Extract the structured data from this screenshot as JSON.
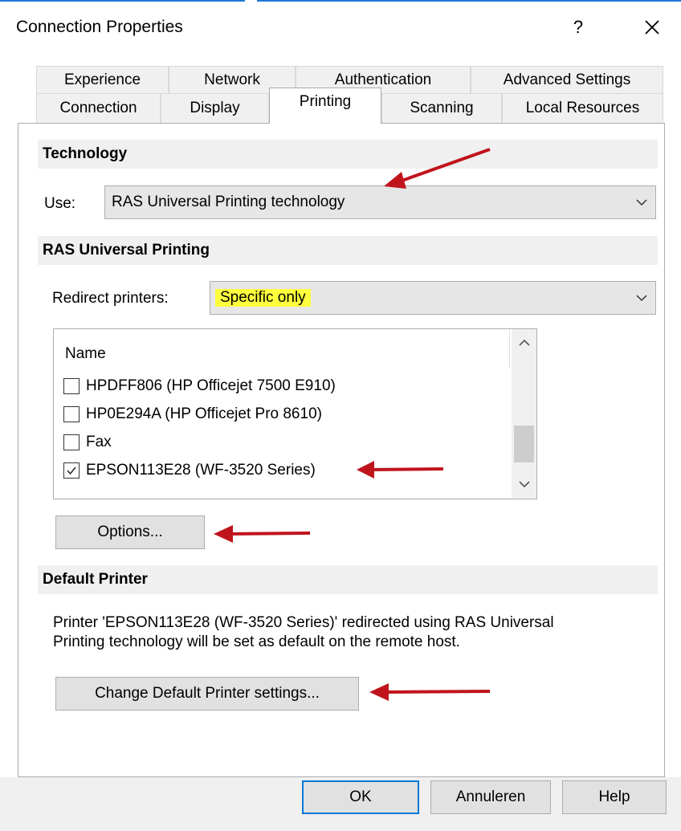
{
  "window": {
    "title": "Connection Properties",
    "help_glyph": "?",
    "close_icon": "close-icon"
  },
  "tabs": {
    "row_top": [
      "Experience",
      "Network",
      "Authentication",
      "Advanced Settings"
    ],
    "row_bottom": [
      "Connection",
      "Display",
      "Printing",
      "Scanning",
      "Local Resources"
    ],
    "active": "Printing"
  },
  "technology": {
    "heading": "Technology",
    "use_label": "Use:",
    "use_value": "RAS Universal Printing technology"
  },
  "universal_printing": {
    "heading": "RAS Universal Printing",
    "redirect_label": "Redirect printers:",
    "redirect_value": "Specific only",
    "list_header": "Name",
    "printers": [
      {
        "name": "HPDFF806 (HP Officejet 7500 E910)",
        "checked": false
      },
      {
        "name": "HP0E294A (HP Officejet Pro 8610)",
        "checked": false
      },
      {
        "name": "Fax",
        "checked": false
      },
      {
        "name": "EPSON113E28 (WF-3520 Series)",
        "checked": true
      }
    ],
    "options_button": "Options..."
  },
  "default_printer": {
    "heading": "Default Printer",
    "description_line1": "Printer 'EPSON113E28 (WF-3520 Series)' redirected using RAS Universal",
    "description_line2": "Printing technology will be set as default on the remote host.",
    "change_button": "Change Default Printer settings..."
  },
  "footer": {
    "ok": "OK",
    "cancel": "Annuleren",
    "help": "Help"
  },
  "colors": {
    "accent": "#0078d7",
    "highlight": "#ffff3d",
    "annotation_arrow": "#c0141c"
  }
}
